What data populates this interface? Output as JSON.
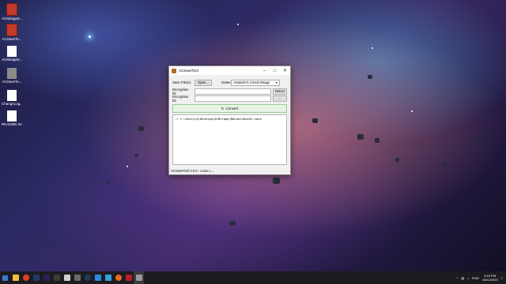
{
  "desktop": {
    "icons": [
      {
        "label": "ACMirage0...",
        "icon": "archive-icon",
        "color": "#c23a2a"
      },
      {
        "label": "ACSaveTo...",
        "icon": "archive-icon",
        "color": "#c23a2a"
      },
      {
        "label": "ACMirage0...",
        "icon": "file-icon",
        "color": "#ffffff"
      },
      {
        "label": "ACSaveTo...",
        "icon": "file-icon",
        "color": "#ffffff"
      },
      {
        "label": "ACSaveTo...",
        "icon": "app-icon",
        "color": "#8a8a8a"
      },
      {
        "label": "ChangeLog...",
        "icon": "file-icon",
        "color": "#ffffff"
      },
      {
        "label": "README.md",
        "icon": "file-icon",
        "color": "#ffffff"
      }
    ]
  },
  "window": {
    "title": "ACSaveTool",
    "save_files_label": "Save File(s):",
    "open_button": "Open...",
    "game_label": "Game:",
    "game_selected": "Assassin's Creed Mirage",
    "decryption_label": "Decryption ID:",
    "detect_button": "Detect",
    "encryption_label": "Encryption ID:",
    "ellipsis_button": "...",
    "convert_button": "Convert",
    "log_line": "-> C:\\Users\\a\\Desktop\\ACMirage\\ManualSave01.save",
    "status": "ACSaveTool 2.5.0 - Linux L..."
  },
  "taskbar": {
    "tray": {
      "lang": "ENG",
      "time": "3:15 PM",
      "date": "10/11/2023"
    }
  }
}
